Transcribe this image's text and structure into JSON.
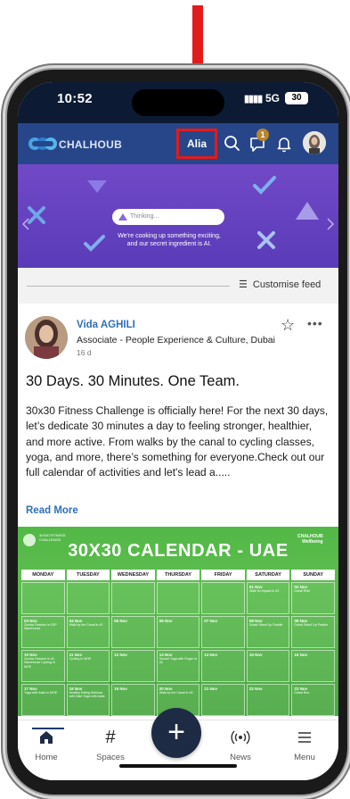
{
  "status_bar": {
    "time": "10:52",
    "network": "5G",
    "battery": "30"
  },
  "header": {
    "brand": "CHALHOUB",
    "ai_button_label": "Alia",
    "notification_count": "1"
  },
  "banner": {
    "thinking_label": "Thinking...",
    "message_line1": "We're cooking up something exciting,",
    "message_line2": "and our secret ingredient is AI."
  },
  "feed_controls": {
    "customise_label": "Customise feed"
  },
  "post": {
    "author": "Vida AGHILI",
    "role": "Associate - People Experience & Culture, Dubai",
    "age": "16 d",
    "title": "30 Days. 30 Minutes. One Team.",
    "body": "30x30 Fitness Challenge is officially here! For the next 30 days, let’s dedicate 30 minutes a day to feeling stronger, healthier, and more active. From walks by the canal to cycling classes, yoga, and more, there’s something for everyone.Check out our full calendar of activities and let's lead a.....",
    "read_more": "Read More"
  },
  "calendar_image": {
    "title": "30X30 CALENDAR - UAE",
    "brand_right_line1": "CHALHOUB",
    "brand_right_line2": "Wellbeing",
    "brand_left": "30X30 FITNESS CHALLENGE",
    "days": [
      "MONDAY",
      "TUESDAY",
      "WEDNESDAY",
      "THURSDAY",
      "FRIDAY",
      "SATURDAY",
      "SUNDAY"
    ],
    "cells": [
      {
        "d": "",
        "t": ""
      },
      {
        "d": "",
        "t": ""
      },
      {
        "d": "",
        "t": ""
      },
      {
        "d": "",
        "t": ""
      },
      {
        "d": "",
        "t": ""
      },
      {
        "d": "01 Nov",
        "t": "Walk for impact in d3"
      },
      {
        "d": "02 Nov",
        "t": "Dubai Ride"
      },
      {
        "d": "03 Nov",
        "t": "Zumba Session in D3P Warehouse"
      },
      {
        "d": "04 Nov",
        "t": "Walk by the Canal in d3"
      },
      {
        "d": "05 Nov",
        "t": ""
      },
      {
        "d": "06 Nov",
        "t": ""
      },
      {
        "d": "07 Nov",
        "t": ""
      },
      {
        "d": "08 Nov",
        "t": "Dubai Stand Up Paddle"
      },
      {
        "d": "09 Nov",
        "t": "Dubai Stand Up Paddle"
      },
      {
        "d": "10 Nov",
        "t": "Zumba Session in d3 Warehouse Cycling in MOE"
      },
      {
        "d": "11 Nov",
        "t": "Cycling in MOE"
      },
      {
        "d": "12 Nov",
        "t": ""
      },
      {
        "d": "13 Nov",
        "t": "Sunset Yoga with Roger in d3"
      },
      {
        "d": "14 Nov",
        "t": ""
      },
      {
        "d": "15 Nov",
        "t": ""
      },
      {
        "d": "16 Nov",
        "t": ""
      },
      {
        "d": "17 Nov",
        "t": "Yoga with Aalia in MOE"
      },
      {
        "d": "18 Nov",
        "t": "Healthy Eating Webinar with Dale Yoga with Aalia"
      },
      {
        "d": "19 Nov",
        "t": ""
      },
      {
        "d": "20 Nov",
        "t": "Walk by the Canal in d3"
      },
      {
        "d": "21 Nov",
        "t": ""
      },
      {
        "d": "22 Nov",
        "t": ""
      },
      {
        "d": "23 Nov",
        "t": "Dubai Run"
      }
    ]
  },
  "bottom_nav": {
    "home": "Home",
    "spaces": "Spaces",
    "news": "News",
    "menu": "Menu"
  },
  "colors": {
    "header_bg": "#27468a",
    "banner_purple": "#6a44c4",
    "link_blue": "#2f6fb7",
    "calendar_green": "#52b846",
    "annotation_red": "#e21b1b"
  }
}
